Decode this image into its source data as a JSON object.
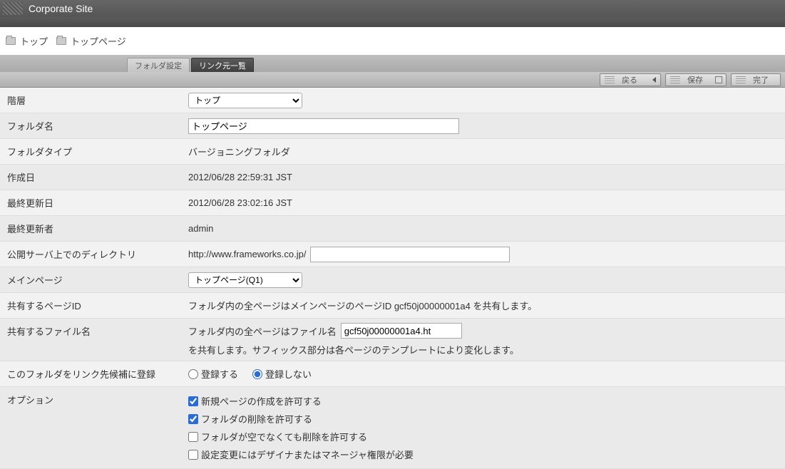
{
  "titlebar": {
    "title": "Corporate Site"
  },
  "breadcrumb": {
    "root": "トップ",
    "current": "トップページ"
  },
  "tabs": {
    "inactive": "フォルダ設定",
    "active": "リンク元一覧"
  },
  "toolbar": {
    "back": "戻る",
    "save": "保存",
    "done": "完了"
  },
  "labels": {
    "level": "階層",
    "folderName": "フォルダ名",
    "folderType": "フォルダタイプ",
    "createdAt": "作成日",
    "updatedAt": "最終更新日",
    "updatedBy": "最終更新者",
    "publicDir": "公開サーバ上でのディレクトリ",
    "mainPage": "メインページ",
    "sharedPageId": "共有するページID",
    "sharedFileName": "共有するファイル名",
    "registerLinkCandidate": "このフォルダをリンク先候補に登録",
    "options": "オプション"
  },
  "values": {
    "levelSelected": "トップ",
    "folderName": "トップページ",
    "folderType": "バージョニングフォルダ",
    "createdAt": "2012/06/28 22:59:31 JST",
    "updatedAt": "2012/06/28 23:02:16 JST",
    "updatedBy": "admin",
    "publicDirPrefix": "http://www.frameworks.co.jp/",
    "publicDirValue": "",
    "mainPageSelected": "トップページ(Q1)",
    "sharedPageIdText": "フォルダ内の全ページはメインページのページID gcf50j00000001a4 を共有します。",
    "sharedFilePrefix": "フォルダ内の全ページはファイル名",
    "sharedFileValue": "gcf50j00000001a4.ht",
    "sharedFileSuffix": "を共有します。サフィックス部分は各ページのテンプレートにより変化します。",
    "registerYes": "登録する",
    "registerNo": "登録しない",
    "opt1": "新規ページの作成を許可する",
    "opt2": "フォルダの削除を許可する",
    "opt3": "フォルダが空でなくても削除を許可する",
    "opt4": "設定変更にはデザイナまたはマネージャ権限が必要"
  }
}
